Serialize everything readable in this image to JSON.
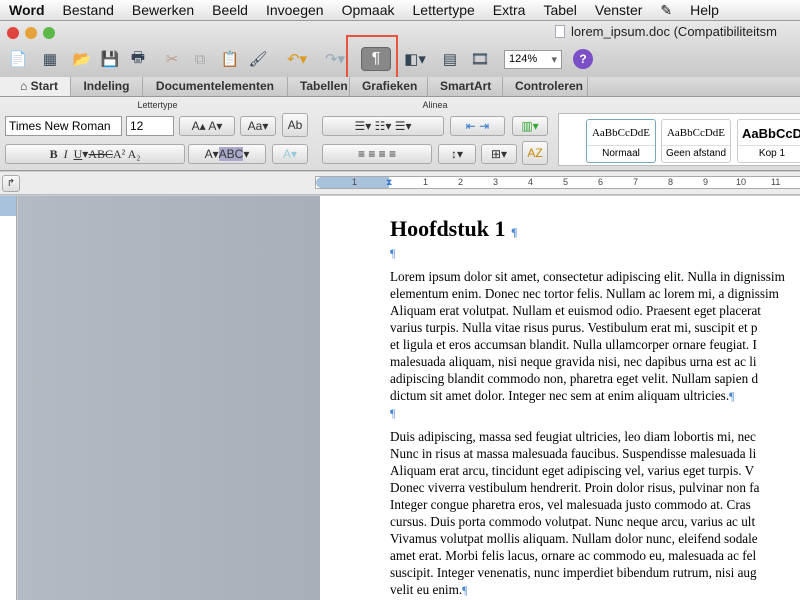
{
  "menubar": {
    "items": [
      "Word",
      "Bestand",
      "Bewerken",
      "Beeld",
      "Invoegen",
      "Opmaak",
      "Lettertype",
      "Extra",
      "Tabel",
      "Venster",
      "Help"
    ]
  },
  "window": {
    "title": "lorem_ipsum.doc (Compatibiliteitsm"
  },
  "toolbar": {
    "show_formatting": "¶",
    "zoom": "124%",
    "help": "?"
  },
  "tabs": [
    "Start",
    "Indeling",
    "Documentelementen",
    "Tabellen",
    "Grafieken",
    "SmartArt",
    "Controleren"
  ],
  "ribbon": {
    "font_group": "Lettertype",
    "paragraph_group": "Alinea",
    "font": "Times New Roman",
    "size": "12",
    "styles": [
      {
        "preview": "AaBbCcDdE",
        "name": "Normaal"
      },
      {
        "preview": "AaBbCcDdE",
        "name": "Geen afstand"
      },
      {
        "preview": "AaBbCcD",
        "name": "Kop 1"
      }
    ]
  },
  "ruler": {
    "ticks": [
      "1",
      "1",
      "2",
      "3",
      "4",
      "5",
      "6",
      "7",
      "8",
      "9",
      "10",
      "11"
    ]
  },
  "document": {
    "heading": "Hoofdstuk 1",
    "pilcrow": "¶",
    "para1": [
      "Lorem ipsum dolor sit amet, consectetur adipiscing elit. Nulla in dignissim",
      "elementum enim. Donec nec tortor felis. Nullam ac lorem mi, a dignissim",
      "Aliquam erat volutpat. Nullam et euismod odio. Praesent eget placerat",
      "varius turpis. Nulla vitae risus purus. Vestibulum erat mi, suscipit et p",
      "et ligula et eros accumsan blandit. Nulla ullamcorper ornare feugiat. I",
      "malesuada aliquam, nisi neque gravida nisi, nec dapibus urna est ac li",
      "adipiscing blandit commodo non, pharetra eget velit. Nullam sapien d",
      "dictum sit amet dolor. Integer nec sem at enim aliquam ultricies."
    ],
    "para2": [
      "Duis adipiscing, massa sed feugiat ultricies, leo diam lobortis mi, nec",
      "Nunc in risus at massa malesuada faucibus. Suspendisse malesuada li",
      "Aliquam erat arcu, tincidunt eget adipiscing vel, varius eget turpis. V",
      "Donec viverra vestibulum hendrerit. Proin dolor risus, pulvinar non fa",
      "Integer congue pharetra eros, vel malesuada justo commodo at. Cras",
      "cursus. Duis porta commodo volutpat. Nunc neque arcu, varius ac ult",
      "Vivamus volutpat mollis aliquam. Nullam dolor nunc, eleifend sodale",
      "amet erat. Morbi felis lacus, ornare ac commodo eu, malesuada ac fel",
      "suscipit. Integer venenatis, nunc imperdiet bibendum rutrum, nisi aug",
      "velit eu enim."
    ]
  }
}
